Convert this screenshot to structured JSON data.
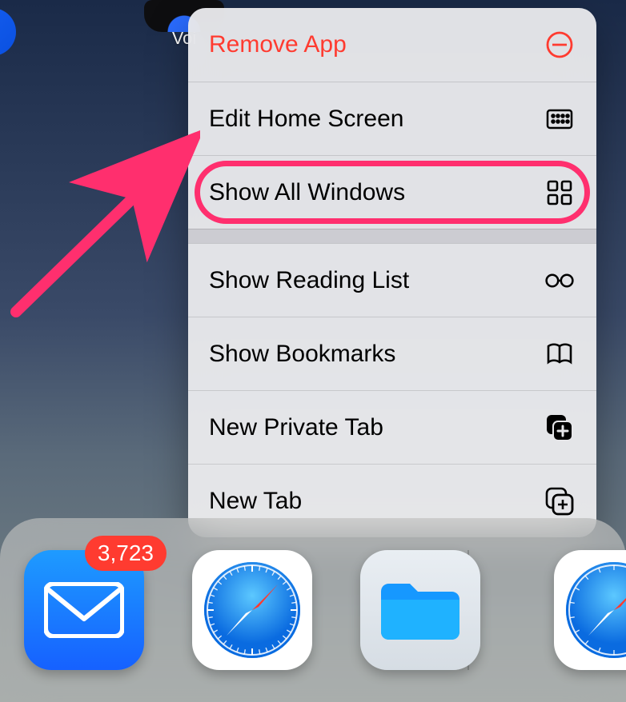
{
  "home": {
    "voice_label": "Voi"
  },
  "menu": {
    "remove_app": "Remove App",
    "edit_home": "Edit Home Screen",
    "show_windows": "Show All Windows",
    "reading_list": "Show Reading List",
    "bookmarks": "Show Bookmarks",
    "new_private": "New Private Tab",
    "new_tab": "New Tab"
  },
  "dock": {
    "mail_badge": "3,723"
  },
  "annotation": {
    "highlighted_item": "show_windows"
  }
}
